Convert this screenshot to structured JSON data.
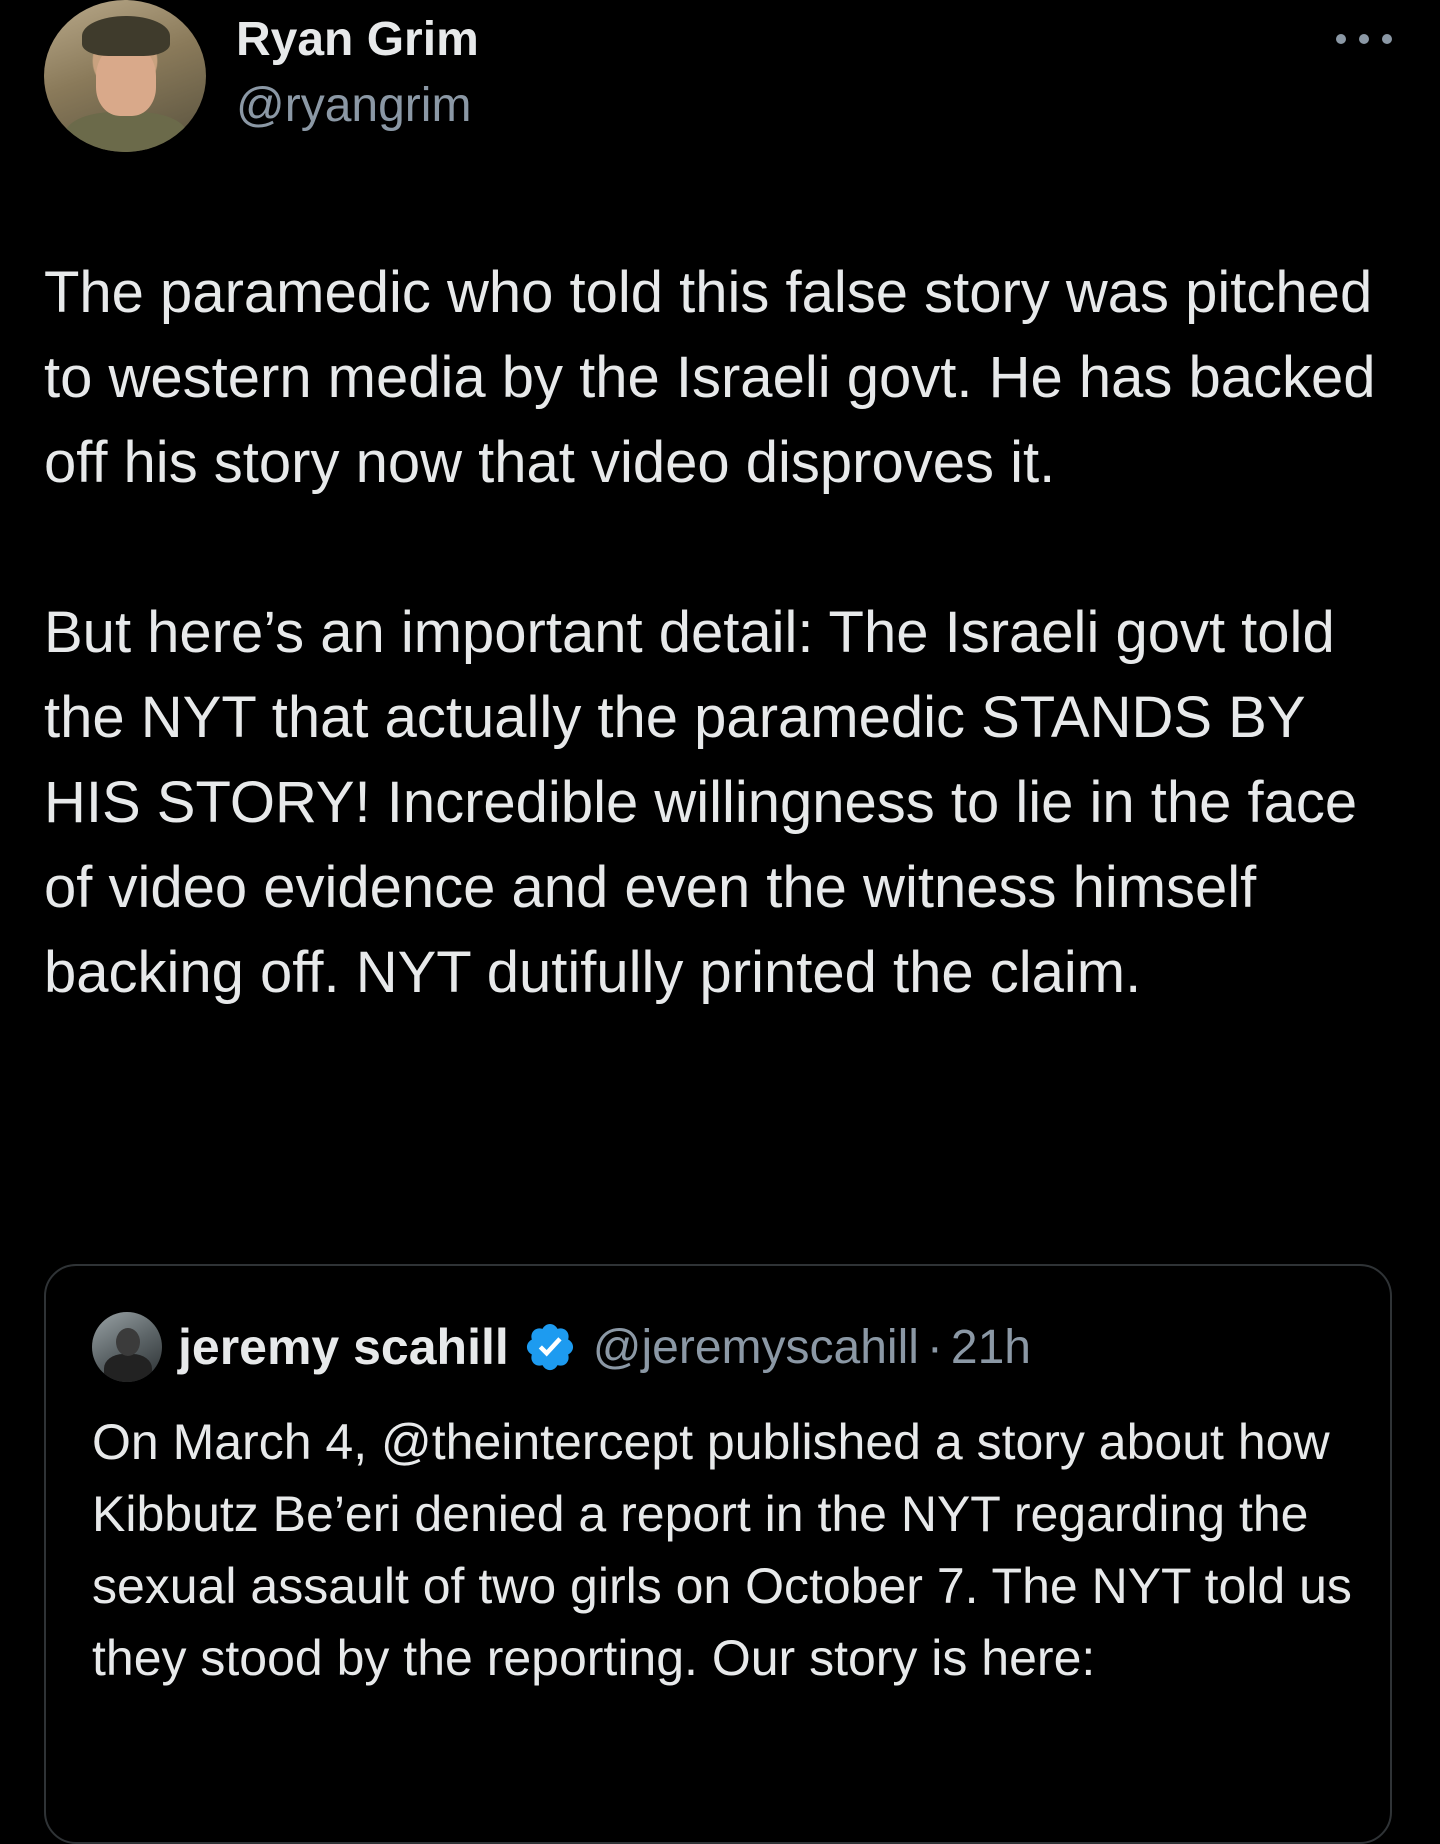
{
  "tweet": {
    "author": {
      "name": "Ryan Grim",
      "handle": "@ryangrim",
      "avatar_icon": "profile-photo"
    },
    "more_icon": "more-horizontal-icon",
    "paragraphs": [
      "The paramedic who told this false story was pitched to western media by the Israeli govt. He has backed off his story now that video disproves it.",
      "But here’s an important detail: The Israeli govt told the NYT that actually the paramedic STANDS BY HIS STORY! Incredible willingness to lie in the face of video evidence and even the witness himself backing off. NYT dutifully printed the claim."
    ]
  },
  "quote": {
    "author": {
      "name": "jeremy scahill",
      "handle": "@jeremyscahill",
      "verified_icon": "verified-badge-icon",
      "verified_color": "#1d9bf0"
    },
    "separator": "·",
    "time": "21h",
    "text": "On March 4, @theintercept published a story about how Kibbutz Be’eri denied a report in the NYT regarding the sexual assault of two girls on October 7. The NYT told us they stood by the reporting. Our story is here:"
  },
  "colors": {
    "background": "#000000",
    "primary_text": "#e7e9ea",
    "secondary_text": "#8b98a5",
    "border": "#2f3336",
    "accent": "#1d9bf0"
  }
}
